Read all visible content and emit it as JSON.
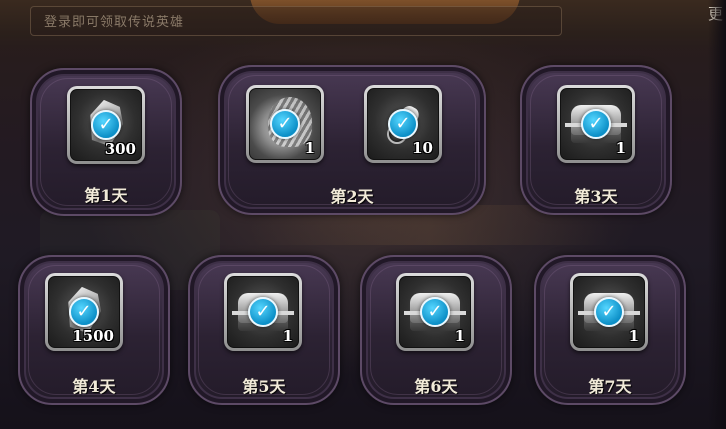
{
  "header": {
    "subtitle": "登录即可领取传说英雄",
    "side_char": "更"
  },
  "days": [
    {
      "label": "第1天",
      "items": [
        {
          "icon": "gem-icon",
          "qty": "300",
          "claimed": true
        }
      ]
    },
    {
      "label": "第2天",
      "items": [
        {
          "icon": "hero-portrait-icon",
          "qty": "1",
          "claimed": true
        },
        {
          "icon": "scroll-icon",
          "qty": "10",
          "claimed": true
        }
      ]
    },
    {
      "label": "第3天",
      "items": [
        {
          "icon": "treasure-chest-icon",
          "qty": "1",
          "claimed": true
        }
      ]
    },
    {
      "label": "第4天",
      "items": [
        {
          "icon": "gem-icon",
          "qty": "1500",
          "claimed": true
        }
      ]
    },
    {
      "label": "第5天",
      "items": [
        {
          "icon": "treasure-chest-icon",
          "qty": "1",
          "claimed": true
        }
      ]
    },
    {
      "label": "第6天",
      "items": [
        {
          "icon": "treasure-chest-icon",
          "qty": "1",
          "claimed": true
        }
      ]
    },
    {
      "label": "第7天",
      "items": [
        {
          "icon": "treasure-chest-icon",
          "qty": "1",
          "claimed": true
        }
      ]
    }
  ],
  "colors": {
    "check": "#0c8fc7",
    "card_border": "#5d4a66",
    "day_text": "#f1ead8"
  }
}
